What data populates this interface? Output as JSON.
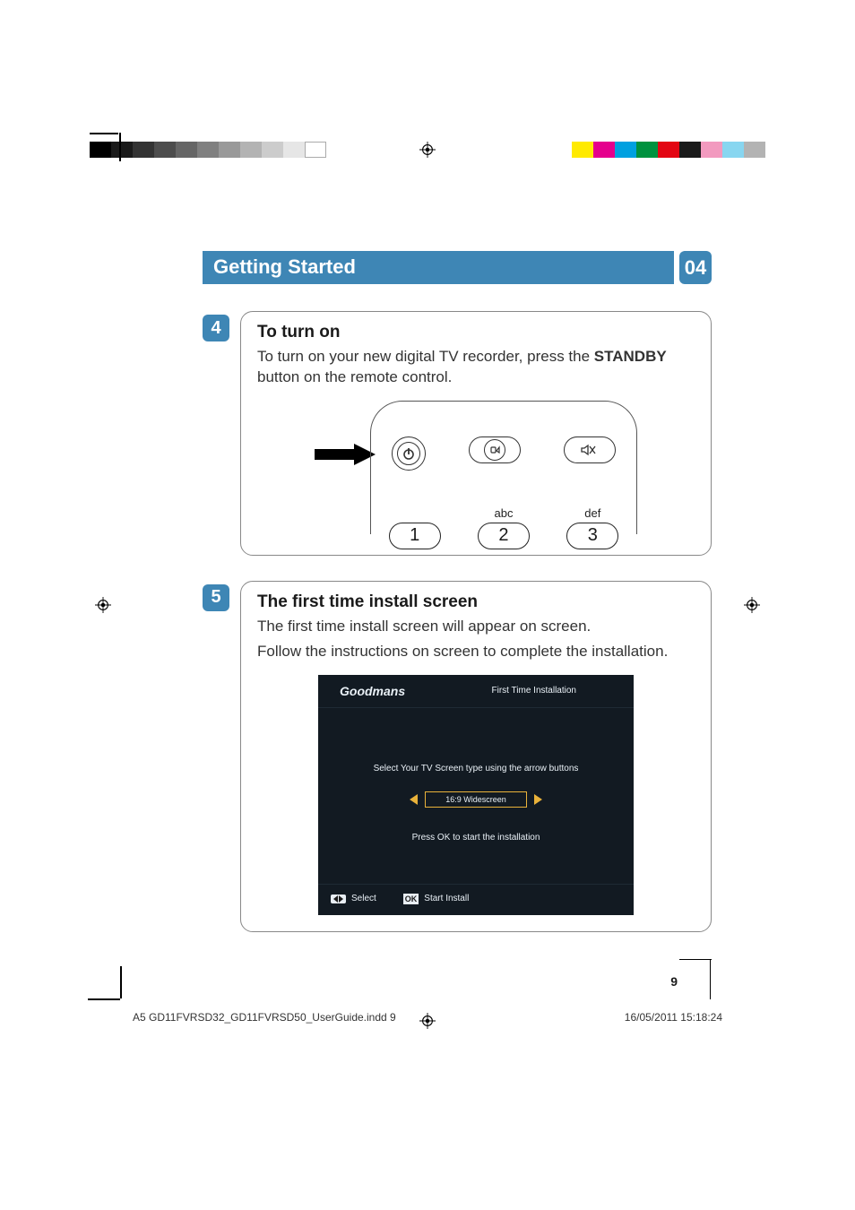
{
  "heading": {
    "title": "Getting Started",
    "chapter": "04"
  },
  "steps": {
    "s4": {
      "num": "4",
      "title": "To turn on",
      "text_a": "To turn on your new digital TV recorder, press the ",
      "text_bold": "STANDBY",
      "text_b": " button on the remote control."
    },
    "s5": {
      "num": "5",
      "title": "The first time install screen",
      "line1": "The first time install screen will appear on screen.",
      "line2": "Follow the instructions on screen to complete the installation."
    }
  },
  "remote": {
    "key_labels": {
      "k2": "abc",
      "k3": "def"
    },
    "keys": {
      "k1": "1",
      "k2": "2",
      "k3": "3"
    }
  },
  "tvui": {
    "brand": "Goodmans",
    "screen_title": "First Time Installation",
    "instr1": "Select Your TV Screen type using the arrow buttons",
    "aspect": "16:9 Widescreen",
    "instr2": "Press OK to start the installation",
    "foot_select": "Select",
    "foot_ok": "OK",
    "foot_start": "Start Install"
  },
  "page_number": "9",
  "imprint": {
    "left": "A5 GD11FVRSD32_GD11FVRSD50_UserGuide.indd   9",
    "right": "16/05/2011   15:18:24"
  }
}
